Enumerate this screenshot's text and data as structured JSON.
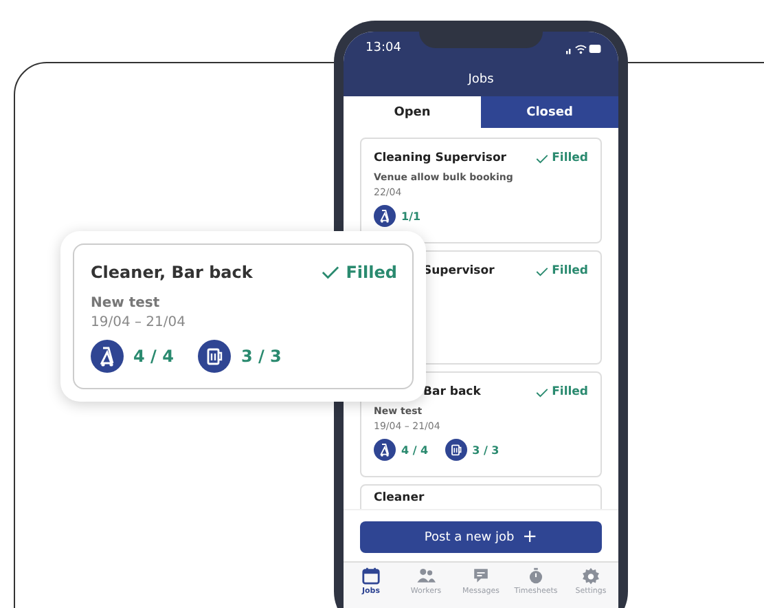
{
  "phone": {
    "status_bar": {
      "time": "13:04"
    },
    "header": {
      "title": "Jobs"
    },
    "tabs": [
      {
        "label": "Open",
        "selected": true
      },
      {
        "label": "Closed",
        "selected": false
      }
    ],
    "jobs": [
      {
        "title": "Cleaning Supervisor",
        "status": "Filled",
        "note": "Venue allow bulk booking",
        "dates": "22/04",
        "roles": [
          {
            "kind": "cleaner",
            "count": "1/1"
          }
        ]
      },
      {
        "title": "Supervisor",
        "status": "Filled",
        "partially_hidden": true
      },
      {
        "title": "Bar back",
        "status": "Filled",
        "partially_hidden": true,
        "note": "New test",
        "dates": "19/04 – 21/04",
        "roles": [
          {
            "kind": "cleaner",
            "count": "4 / 4"
          },
          {
            "kind": "bar",
            "count": "3 / 3"
          }
        ]
      },
      {
        "title": "Cleaner"
      }
    ],
    "post_button": {
      "label": "Post a new job",
      "icon": "+"
    },
    "nav": [
      {
        "kind": "calendar",
        "label": "Jobs",
        "selected": true
      },
      {
        "kind": "people",
        "label": "Workers",
        "selected": false
      },
      {
        "kind": "chat",
        "label": "Messages",
        "selected": false
      },
      {
        "kind": "stopwatch",
        "label": "Timesheets",
        "selected": false
      },
      {
        "kind": "gear",
        "label": "Settings",
        "selected": false
      }
    ]
  },
  "callout": {
    "title": "Cleaner, Bar back",
    "status": "Filled",
    "note": "New test",
    "dates": "19/04 – 21/04",
    "roles": [
      {
        "kind": "cleaner",
        "count": "4 / 4"
      },
      {
        "kind": "bar",
        "count": "3 / 3"
      }
    ]
  }
}
